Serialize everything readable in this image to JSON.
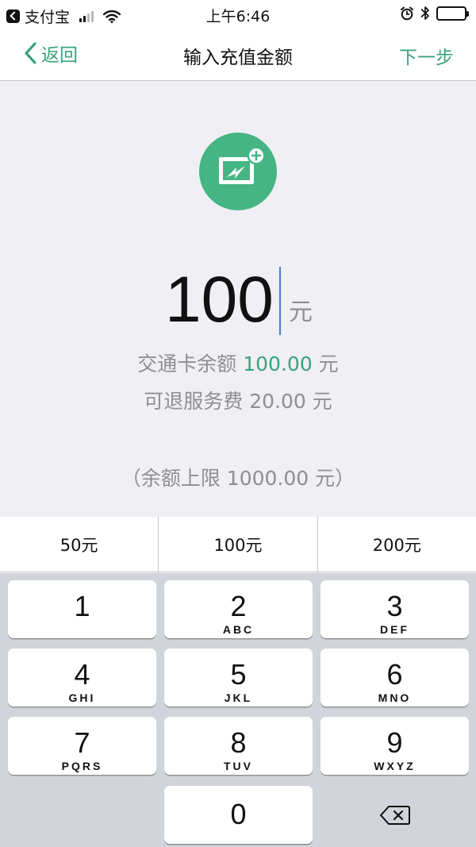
{
  "status_bar": {
    "app_name": "支付宝",
    "time": "上午6:46"
  },
  "nav": {
    "back_label": "返回",
    "title": "输入充值金额",
    "next_label": "下一步"
  },
  "amount": {
    "value": "100",
    "unit": "元"
  },
  "balance": {
    "label": "交通卡余额 ",
    "value": "100.00",
    "unit": " 元"
  },
  "fee": {
    "text": "可退服务费 20.00 元"
  },
  "limit": {
    "text": "（余额上限 1000.00 元）"
  },
  "quick_amounts": [
    "50元",
    "100元",
    "200元"
  ],
  "keypad": {
    "keys": [
      {
        "num": "1",
        "letters": ""
      },
      {
        "num": "2",
        "letters": "ABC"
      },
      {
        "num": "3",
        "letters": "DEF"
      },
      {
        "num": "4",
        "letters": "GHI"
      },
      {
        "num": "5",
        "letters": "JKL"
      },
      {
        "num": "6",
        "letters": "MNO"
      },
      {
        "num": "7",
        "letters": "PQRS"
      },
      {
        "num": "8",
        "letters": "TUV"
      },
      {
        "num": "9",
        "letters": "WXYZ"
      },
      {
        "num": "0",
        "letters": ""
      }
    ]
  },
  "colors": {
    "accent": "#3aa37a",
    "icon_bg": "#45b584",
    "caret": "#4a7bd6"
  },
  "icons": {
    "card_icon": "card-add-icon",
    "backspace_icon": "backspace-icon"
  }
}
